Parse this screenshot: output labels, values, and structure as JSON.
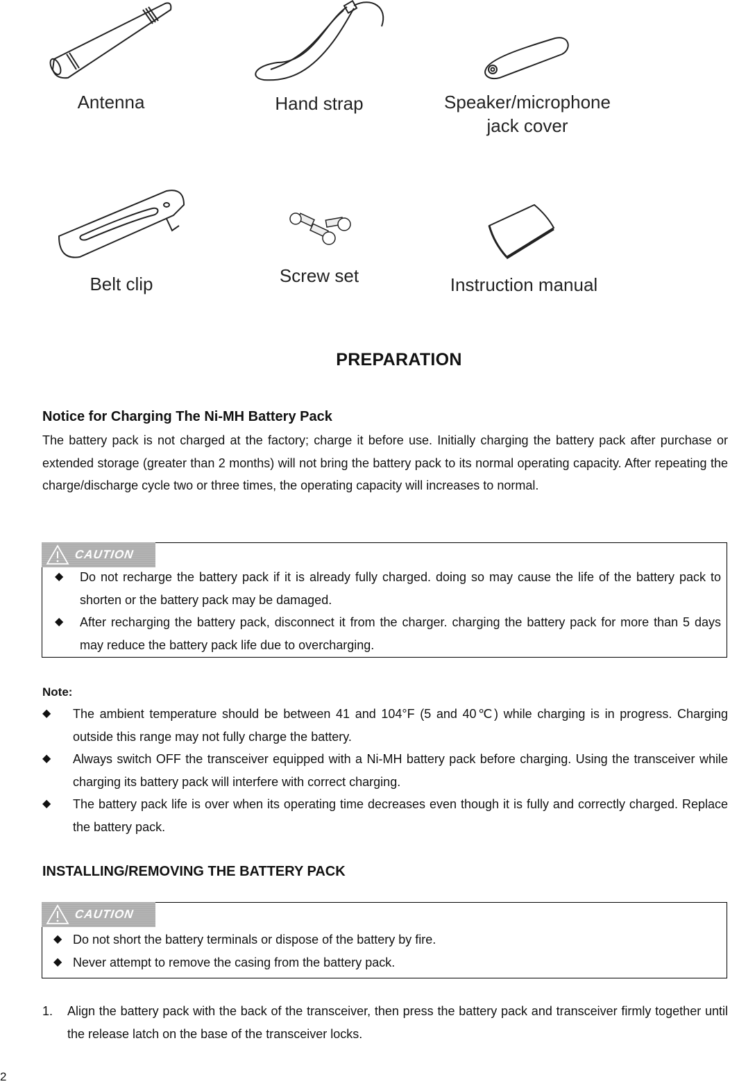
{
  "accessories": {
    "antenna": "Antenna",
    "hand_strap": "Hand strap",
    "jack_cover_line1": "Speaker/microphone",
    "jack_cover_line2": "jack cover",
    "belt_clip": "Belt clip",
    "screw_set": "Screw set",
    "instruction_manual": "Instruction manual"
  },
  "section_title": "PREPARATION",
  "charging_notice": {
    "heading": "Notice for Charging The Ni-MH Battery Pack",
    "body": "The battery pack is not charged at the factory; charge it before use. Initially charging the battery pack after purchase or extended storage (greater than 2 months) will not bring the battery pack to its normal operating capacity. After repeating the charge/discharge cycle two or three times, the operating capacity will increases to normal."
  },
  "caution_1": {
    "badge": "CAUTION",
    "items": [
      "Do not recharge the battery pack if it is already fully charged. doing so may cause the life of the battery pack to shorten or the battery pack may be damaged.",
      "After recharging the battery pack, disconnect it from the charger. charging the battery pack for more than 5 days may reduce the battery pack life due to overcharging."
    ]
  },
  "note": {
    "label": "Note:",
    "items": [
      "The ambient temperature should be between 41 and 104°F (5 and 40℃) while charging is in progress. Charging outside this range may not fully charge the battery.",
      "Always switch OFF the transceiver equipped with a Ni-MH battery pack before charging. Using the transceiver while charging its battery pack will interfere with correct charging.",
      "The battery pack life is over when its operating time decreases even though it is fully and correctly charged. Replace the battery pack."
    ]
  },
  "installing": {
    "heading": "INSTALLING/REMOVING THE BATTERY PACK",
    "caution": {
      "badge": "CAUTION",
      "items": [
        "Do not short the battery terminals or dispose of the battery by fire.",
        "Never attempt to remove the casing from the battery pack."
      ]
    },
    "steps": [
      {
        "number": "1.",
        "text": "Align the battery pack with the back of the transceiver, then press the battery pack and transceiver firmly together until the release latch on the base of the transceiver locks."
      }
    ]
  },
  "bullet_glyph": "◆",
  "page_number": "2"
}
